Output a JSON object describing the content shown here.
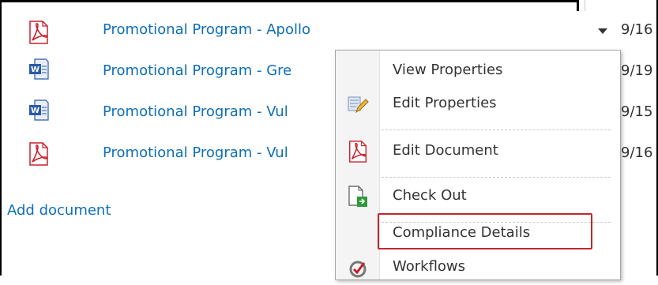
{
  "documents": [
    {
      "name": "Promotional Program - Apollo",
      "type": "pdf",
      "date": "9/16"
    },
    {
      "name": "Promotional Program - Gre",
      "type": "word",
      "date": "9/19"
    },
    {
      "name": "Promotional Program - Vul",
      "type": "word",
      "date": "9/15"
    },
    {
      "name": "Promotional Program - Vul",
      "type": "pdf",
      "date": "9/16"
    }
  ],
  "add_document_label": "Add document",
  "context_menu": {
    "items": [
      {
        "label": "View Properties",
        "icon": "none"
      },
      {
        "label": "Edit Properties",
        "icon": "edit-properties-icon"
      },
      {
        "label": "Edit Document",
        "icon": "pdf-icon"
      },
      {
        "label": "Check Out",
        "icon": "check-out-icon"
      },
      {
        "label": "Compliance Details",
        "icon": "none"
      },
      {
        "label": "Workflows",
        "icon": "workflows-icon"
      }
    ],
    "highlighted_item": "Compliance Details"
  },
  "colors": {
    "link": "#0e6fb8",
    "highlight_border": "#c0272d",
    "pdf_red": "#c8202a",
    "word_blue": "#2a5aa7"
  }
}
